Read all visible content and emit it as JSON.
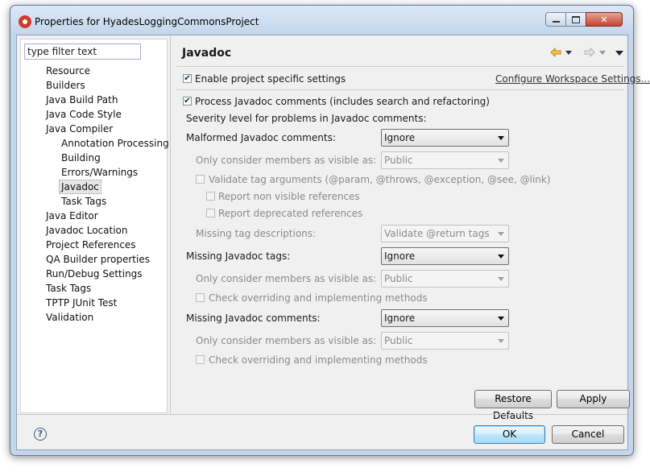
{
  "window": {
    "title": "Properties for HyadesLoggingCommonsProject",
    "icon": "eclipse-app-icon"
  },
  "filter": {
    "value": "type filter text"
  },
  "tree": [
    {
      "label": "Resource",
      "level": 0
    },
    {
      "label": "Builders",
      "level": 0
    },
    {
      "label": "Java Build Path",
      "level": 0
    },
    {
      "label": "Java Code Style",
      "level": 0
    },
    {
      "label": "Java Compiler",
      "level": 0
    },
    {
      "label": "Annotation Processing",
      "level": 1
    },
    {
      "label": "Building",
      "level": 1
    },
    {
      "label": "Errors/Warnings",
      "level": 1
    },
    {
      "label": "Javadoc",
      "level": 1,
      "selected": true
    },
    {
      "label": "Task Tags",
      "level": 1
    },
    {
      "label": "Java Editor",
      "level": 0
    },
    {
      "label": "Javadoc Location",
      "level": 0
    },
    {
      "label": "Project References",
      "level": 0
    },
    {
      "label": "QA Builder properties",
      "level": 0
    },
    {
      "label": "Run/Debug Settings",
      "level": 0
    },
    {
      "label": "Task Tags",
      "level": 0
    },
    {
      "label": "TPTP JUnit Test",
      "level": 0
    },
    {
      "label": "Validation",
      "level": 0
    }
  ],
  "page": {
    "title": "Javadoc",
    "enable_project_specific": {
      "label": "Enable project specific settings",
      "checked": true
    },
    "configure_link": "Configure Workspace Settings...",
    "process_javadoc": {
      "label": "Process Javadoc comments (includes search and refactoring)",
      "checked": true
    },
    "severity_heading": "Severity level for problems in Javadoc comments:",
    "malformed": {
      "label": "Malformed Javadoc comments:",
      "value": "Ignore",
      "visibility_label": "Only consider members as visible as:",
      "visibility_value": "Public",
      "validate_tags": {
        "label": "Validate tag arguments (@param, @throws, @exception, @see, @link)",
        "checked": false
      },
      "report_non_visible": {
        "label": "Report non visible references",
        "checked": false
      },
      "report_deprecated": {
        "label": "Report deprecated references",
        "checked": false
      },
      "missing_desc_label": "Missing tag descriptions:",
      "missing_desc_value": "Validate @return tags"
    },
    "missing_tags": {
      "label": "Missing Javadoc tags:",
      "value": "Ignore",
      "visibility_label": "Only consider members as visible as:",
      "visibility_value": "Public",
      "check_overriding": {
        "label": "Check overriding and implementing methods",
        "checked": false
      }
    },
    "missing_comments": {
      "label": "Missing Javadoc comments:",
      "value": "Ignore",
      "visibility_label": "Only consider members as visible as:",
      "visibility_value": "Public",
      "check_overriding": {
        "label": "Check overriding and implementing methods",
        "checked": false
      }
    },
    "restore_defaults": "Restore Defaults",
    "apply": "Apply"
  },
  "footer": {
    "ok": "OK",
    "cancel": "Cancel"
  },
  "colors": {
    "accent": "#3c7fb1",
    "disabled_text": "#8a8a8a",
    "back_arrow": "#e0a21a"
  }
}
